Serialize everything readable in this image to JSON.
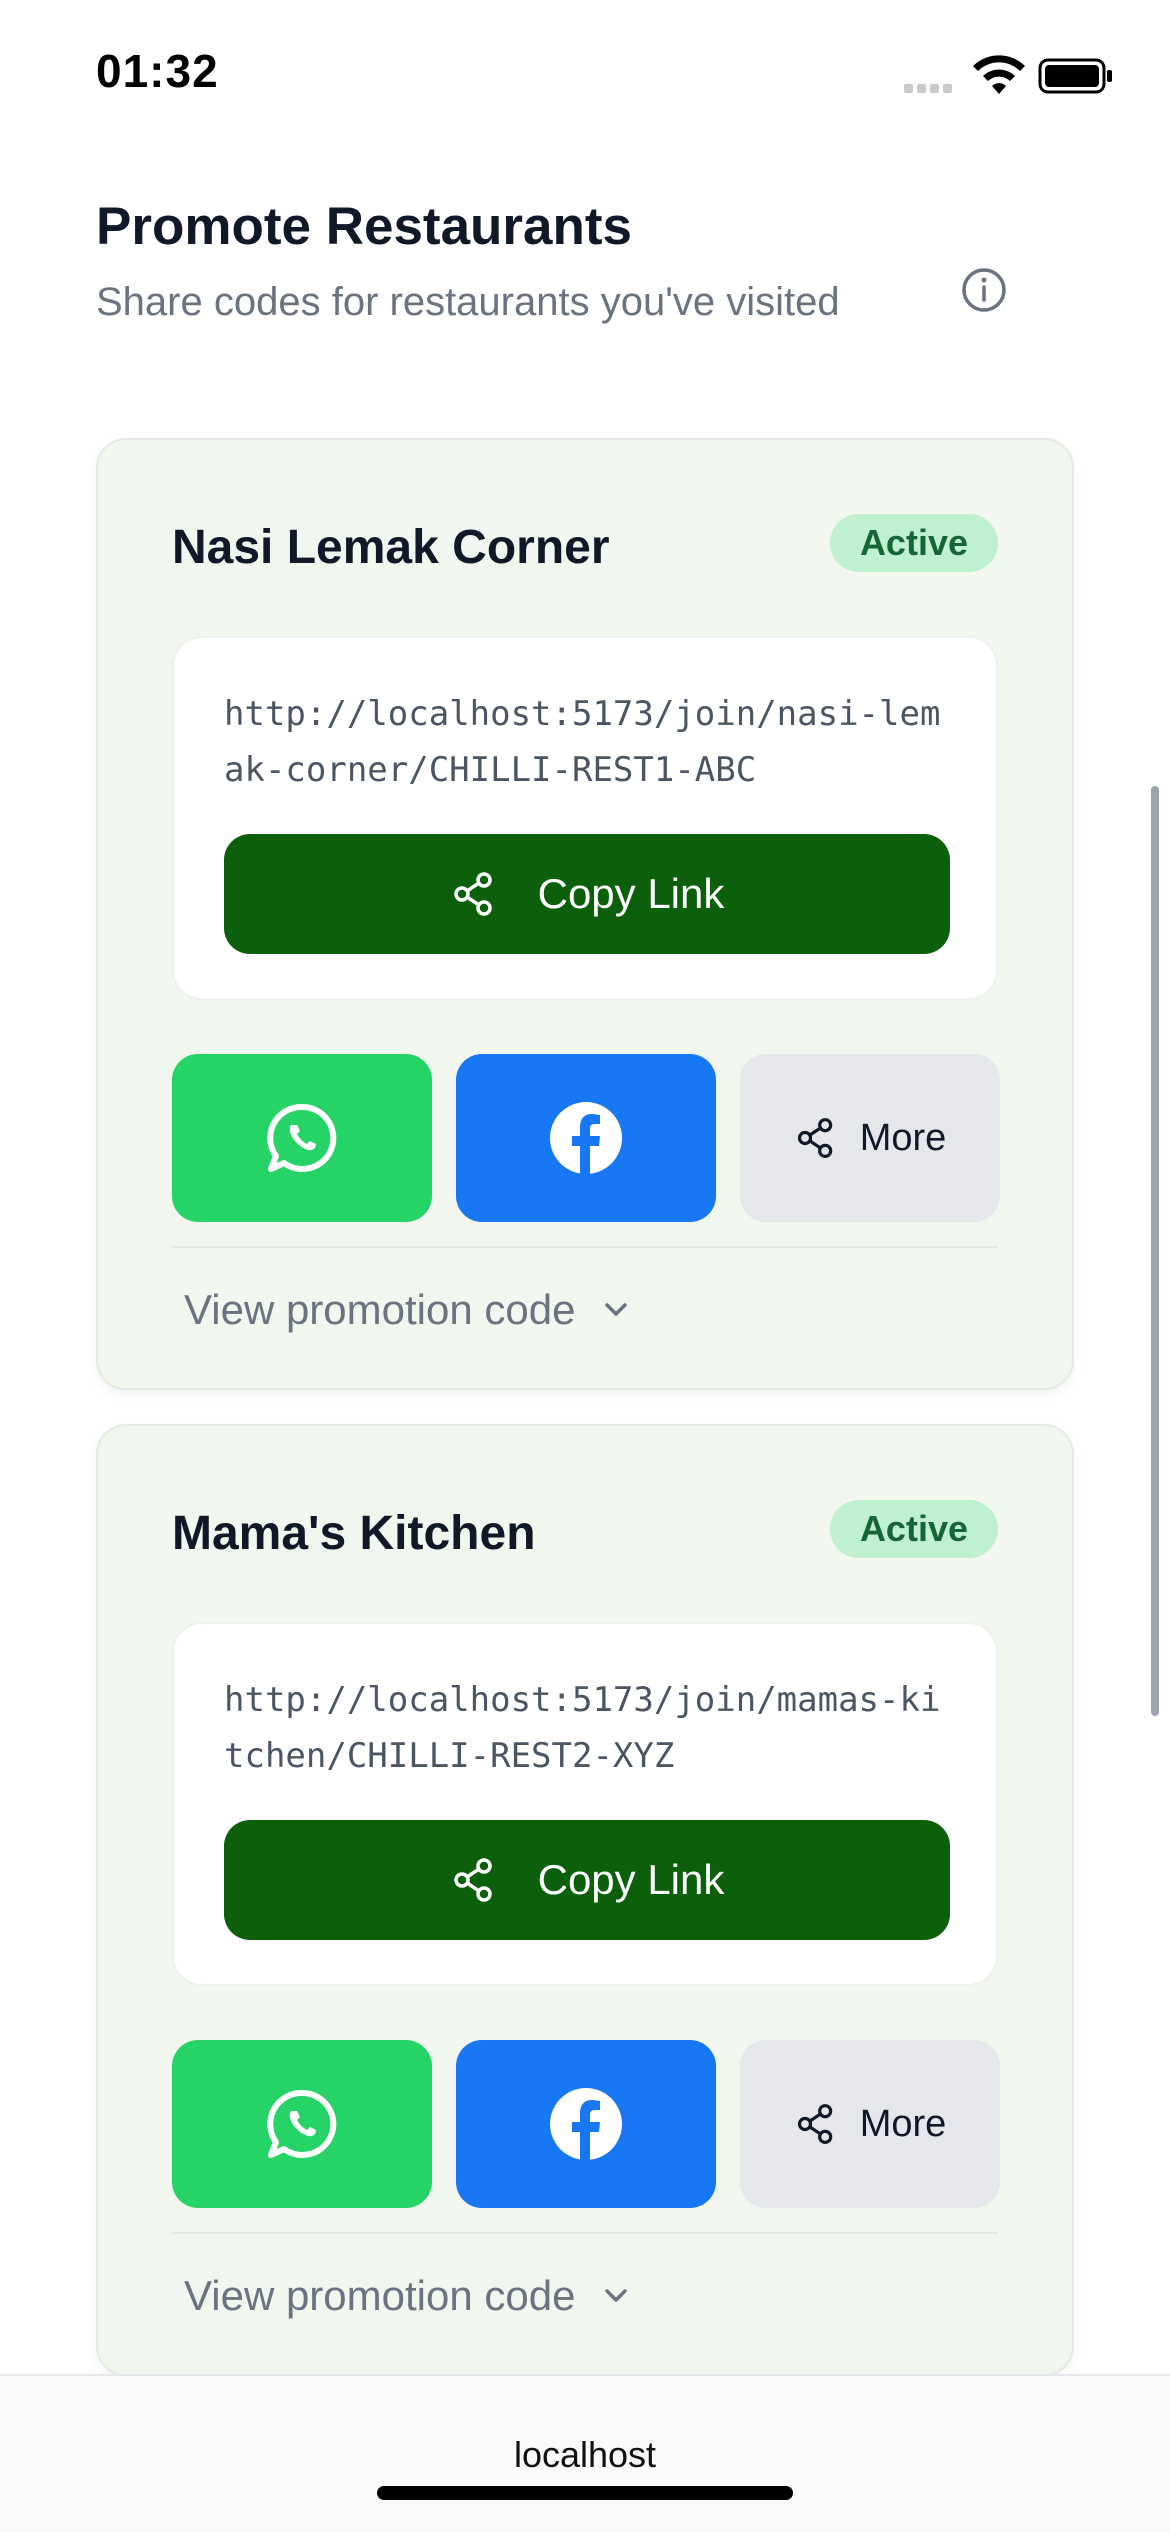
{
  "status_bar": {
    "time": "01:32"
  },
  "header": {
    "title": "Promote Restaurants",
    "subtitle": "Share codes for restaurants you've visited"
  },
  "restaurants": [
    {
      "name": "Nasi Lemak Corner",
      "status": "Active",
      "link": "http://localhost:5173/join/nasi-lemak-corner/CHILLI-REST1-ABC",
      "copy_label": "Copy Link",
      "more_label": "More",
      "view_code_label": "View promotion code"
    },
    {
      "name": "Mama's Kitchen",
      "status": "Active",
      "link": "http://localhost:5173/join/mamas-kitchen/CHILLI-REST2-XYZ",
      "copy_label": "Copy Link",
      "more_label": "More",
      "view_code_label": "View promotion code"
    }
  ],
  "url_bar": {
    "host": "localhost"
  },
  "colors": {
    "primary_green": "#0c600c",
    "whatsapp": "#25d366",
    "facebook": "#1877f2",
    "badge_bg": "#bff0cf",
    "badge_text": "#166534"
  },
  "icons": [
    "signal-icon",
    "wifi-icon",
    "battery-icon",
    "info-icon",
    "share-icon",
    "whatsapp-icon",
    "facebook-icon",
    "chevron-down-icon"
  ]
}
